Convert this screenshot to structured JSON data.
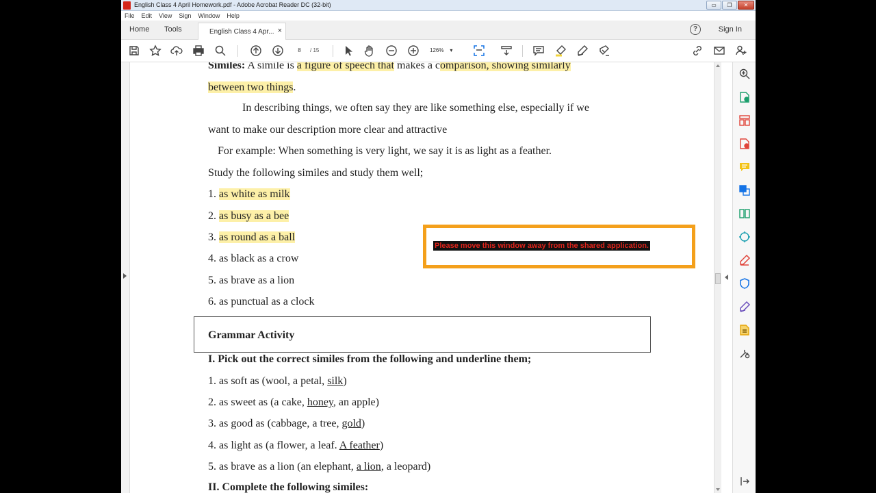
{
  "window": {
    "title": "English  Class 4 April Homework.pdf - Adobe Acrobat Reader DC (32-bit)",
    "minimize": "▭",
    "restore": "❐",
    "close": "✕"
  },
  "menu": [
    "File",
    "Edit",
    "View",
    "Sign",
    "Window",
    "Help"
  ],
  "tabs": {
    "home": "Home",
    "tools": "Tools",
    "document": "English  Class 4 Apr...",
    "close": "×",
    "help": "?",
    "sign_in": "Sign In"
  },
  "toolbar": {
    "page_current": "8",
    "page_total": "/ 15",
    "zoom": "126%",
    "zoom_caret": "▾",
    "icons": [
      "save-icon",
      "bookmark-star-icon",
      "upload-cloud-icon",
      "print-icon",
      "search-zoom-icon",
      "page-up-icon",
      "page-down-icon",
      "select-arrow-icon",
      "hand-tool-icon",
      "zoom-out-icon",
      "zoom-in-icon",
      "page-fit-icon",
      "scroll-mode-icon",
      "comment-icon",
      "highlight-icon",
      "draw-icon",
      "stamp-icon",
      "share-link-icon",
      "email-icon",
      "add-user-icon"
    ]
  },
  "document": {
    "similes_heading": "Similes:",
    "similes_def_1": " A simile is ",
    "similes_def_hl1": "a figure of speech that",
    "similes_def_2": " makes a c",
    "similes_def_hl2": "omparison, showing similarly",
    "similes_def_hl3": "between two things",
    "similes_def_end": ".",
    "para_1": "In describing things, we often say they are like something else, especially if we",
    "para_2": "want to make our description more clear and attractive",
    "example": "For example: When something is very light, we say it is as light as a feather.",
    "study": "Study the following similes and study them well;",
    "similes": [
      {
        "num": "1. ",
        "text": "as white as milk",
        "highlight": true
      },
      {
        "num": "2. ",
        "text": "as busy as a bee",
        "highlight": true
      },
      {
        "num": "3. ",
        "text": "as round as a ball",
        "highlight": true
      },
      {
        "num": "4. ",
        "text": "as black as a crow",
        "highlight": false
      },
      {
        "num": "5. ",
        "text": "as brave as a lion",
        "highlight": false
      },
      {
        "num": "6. ",
        "text": "as punctual as a clock",
        "highlight": false
      }
    ],
    "grammar_heading": "Grammar Activity",
    "section_1": "I. Pick out the correct similes from the following and underline them;",
    "exercises": [
      {
        "pre": "1. as soft as (wool, a petal, ",
        "answer": "silk",
        "post": ")"
      },
      {
        "pre": "2. as sweet as (a cake, ",
        "answer": "honey",
        "post": ", an apple)"
      },
      {
        "pre": "3. as good as (cabbage, a tree, ",
        "answer": "gold",
        "post": ")"
      },
      {
        "pre": "4. as light as (a flower, a leaf. ",
        "answer": "A feather",
        "post": ")"
      },
      {
        "pre": "5. as brave as a lion (an elephant, ",
        "answer": "a lion",
        "post": ", a leopard)"
      }
    ],
    "section_2": "II. Complete the following similes:"
  },
  "overlay": {
    "message": "Please move this window away from the shared application.",
    "border_color": "#f4a01b",
    "text_color": "#e0241b"
  },
  "right_pane": {
    "icons": [
      "zoom-in-page-icon",
      "create-pdf-icon",
      "organize-pages-icon",
      "export-pdf-icon",
      "comment-tool-icon",
      "combine-files-icon",
      "compress-icon",
      "scan-icon",
      "fill-sign-icon",
      "protect-icon",
      "sign-pen-icon",
      "edit-pdf-icon",
      "more-tools-icon",
      "expand-pane-icon"
    ]
  },
  "colors": {
    "highlight": "#fdf0a8",
    "accent_blue": "#1473e6"
  }
}
